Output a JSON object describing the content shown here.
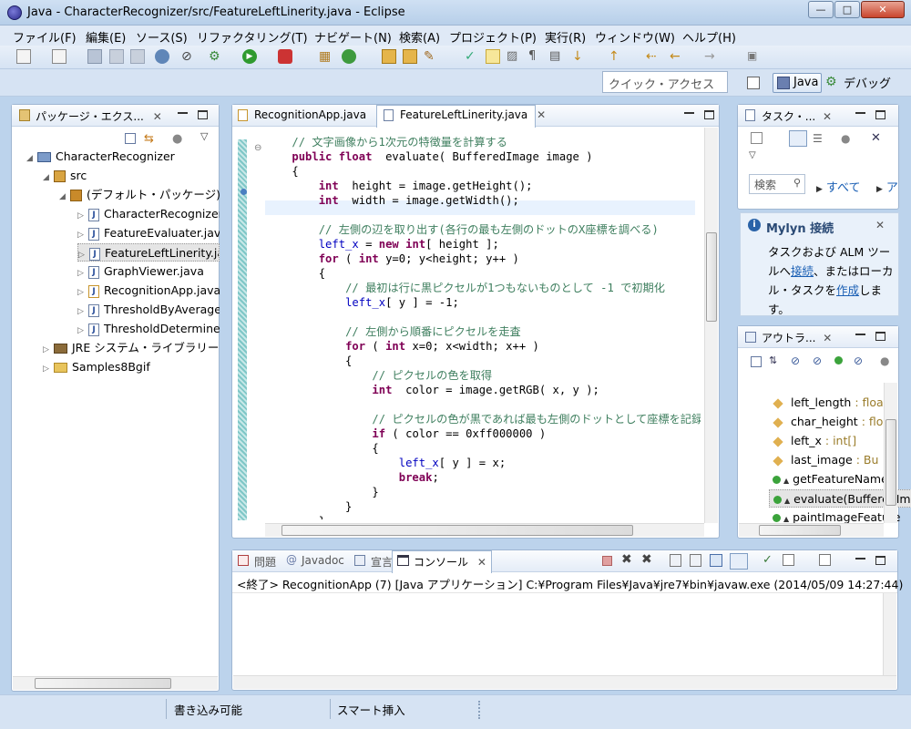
{
  "window": {
    "title": "Java - CharacterRecognizer/src/FeatureLeftLinerity.java - Eclipse"
  },
  "menu": [
    "ファイル(F)",
    "編集(E)",
    "ソース(S)",
    "リファクタリング(T)",
    "ナビゲート(N)",
    "検索(A)",
    "プロジェクト(P)",
    "実行(R)",
    "ウィンドウ(W)",
    "ヘルプ(H)"
  ],
  "quick_access": "クイック・アクセス",
  "perspectives": {
    "java": "Java",
    "debug": "デバッグ"
  },
  "package_explorer": {
    "tab": "パッケージ・エクス...",
    "items": [
      {
        "label": "CharacterRecognizer"
      },
      {
        "label": "src"
      },
      {
        "label": "(デフォルト・パッケージ)"
      },
      {
        "label": "CharacterRecognizer.java"
      },
      {
        "label": "FeatureEvaluater.java"
      },
      {
        "label": "FeatureLeftLinerity.java"
      },
      {
        "label": "GraphViewer.java"
      },
      {
        "label": "RecognitionApp.java"
      },
      {
        "label": "ThresholdByAverage.java"
      },
      {
        "label": "ThresholdDetermine.java"
      },
      {
        "label": "JRE システム・ライブラリー"
      },
      {
        "label": "Samples8Bgif"
      }
    ]
  },
  "editor": {
    "tabs": [
      "RecognitionApp.java",
      "FeatureLeftLinerity.java"
    ],
    "lines": [
      "    // 文字画像から1次元の特徴量を計算する",
      "    public float  evaluate( BufferedImage image )",
      "    {",
      "        int  height = image.getHeight();",
      "        int  width = image.getWidth();",
      "",
      "        // 左側の辺を取り出す(各行の最も左側のドットのX座標を調べる)",
      "        left_x = new int[ height ];",
      "        for ( int y=0; y<height; y++ )",
      "        {",
      "            // 最初は行に黒ピクセルが1つもないものとして -1 で初期化",
      "            left_x[ y ] = -1;",
      "",
      "            // 左側から順番にピクセルを走査",
      "            for ( int x=0; x<width; x++ )",
      "            {",
      "                // ピクセルの色を取得",
      "                int  color = image.getRGB( x, y );",
      "",
      "                // ピクセルの色が黒であれば最も左側のドットとして座標を記録",
      "                if ( color == 0xff000000 )",
      "                {",
      "                    left_x[ y ] = x;",
      "                    break;",
      "                }",
      "            }",
      "        }"
    ]
  },
  "task_list": {
    "tab": "タスク・...",
    "search": "検索",
    "all": "すべて",
    "activate": "ア"
  },
  "mylyn": {
    "title": "Mylyn 接続",
    "text1": "タスクおよび ALM ツー",
    "text2a": "ルへ",
    "link_connect": "接続",
    "text2b": "、またはローカ",
    "text3a": "ル・タスクを",
    "link_create": "作成",
    "text3b": "しま",
    "text4": "す。"
  },
  "outline": {
    "tab": "アウトラ...",
    "items": [
      {
        "label": "left_length",
        "type": ": float"
      },
      {
        "label": "char_height",
        "type": ": float"
      },
      {
        "label": "left_x",
        "type": ": int[]"
      },
      {
        "label": "last_image",
        "type": ": Bu"
      },
      {
        "label": "getFeatureName()",
        "type": ""
      },
      {
        "label": "evaluate(BufferedImage)",
        "type": ""
      },
      {
        "label": "paintImageFeature",
        "type": ""
      }
    ]
  },
  "bottom_tabs": [
    "問題",
    "Javadoc",
    "宣言",
    "コンソール"
  ],
  "console": {
    "text": "<終了> RecognitionApp (7) [Java アプリケーション] C:¥Program Files¥Java¥jre7¥bin¥javaw.exe (2014/05/09 14:27:44)"
  },
  "status": {
    "writable": "書き込み可能",
    "insert_mode": "スマート挿入"
  },
  "colors": {
    "keyword": "#7f0055",
    "comment": "#3f7f5f",
    "field": "#0000c0"
  }
}
